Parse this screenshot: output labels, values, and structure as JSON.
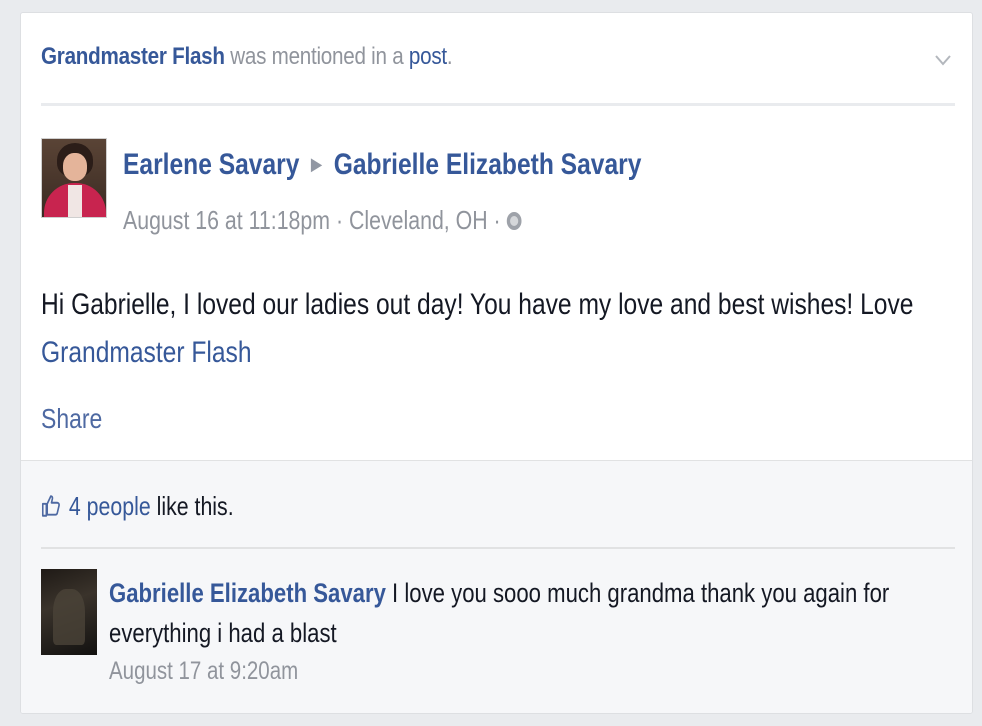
{
  "story_header": {
    "subject": "Grandmaster Flash",
    "mid_text": " was mentioned in a ",
    "object": "post",
    "end": "."
  },
  "post": {
    "author": "Earlene Savary",
    "recipient": "Gabrielle Elizabeth Savary",
    "timestamp": "August 16 at 11:18pm",
    "location": "Cleveland, OH",
    "separator": " · ",
    "text": "Hi Gabrielle, I loved our ladies out day! You have my love and best wishes! Love",
    "mention": "Grandmaster Flash",
    "share_label": "Share"
  },
  "likes": {
    "count_text": "4 people",
    "suffix": " like this."
  },
  "comment": {
    "author": "Gabrielle Elizabeth Savary",
    "text": "I love you sooo much grandma thank you again for everything i had a blast",
    "timestamp": "August 17 at 9:20am"
  },
  "icons": {
    "chevron": "chevron-down-icon",
    "arrow": "right-arrow-icon",
    "privacy": "globe-icon",
    "like": "thumbs-up-icon"
  },
  "colors": {
    "link": "#365899",
    "meta": "#90949c",
    "text": "#141823",
    "background": "#e9ebee"
  }
}
